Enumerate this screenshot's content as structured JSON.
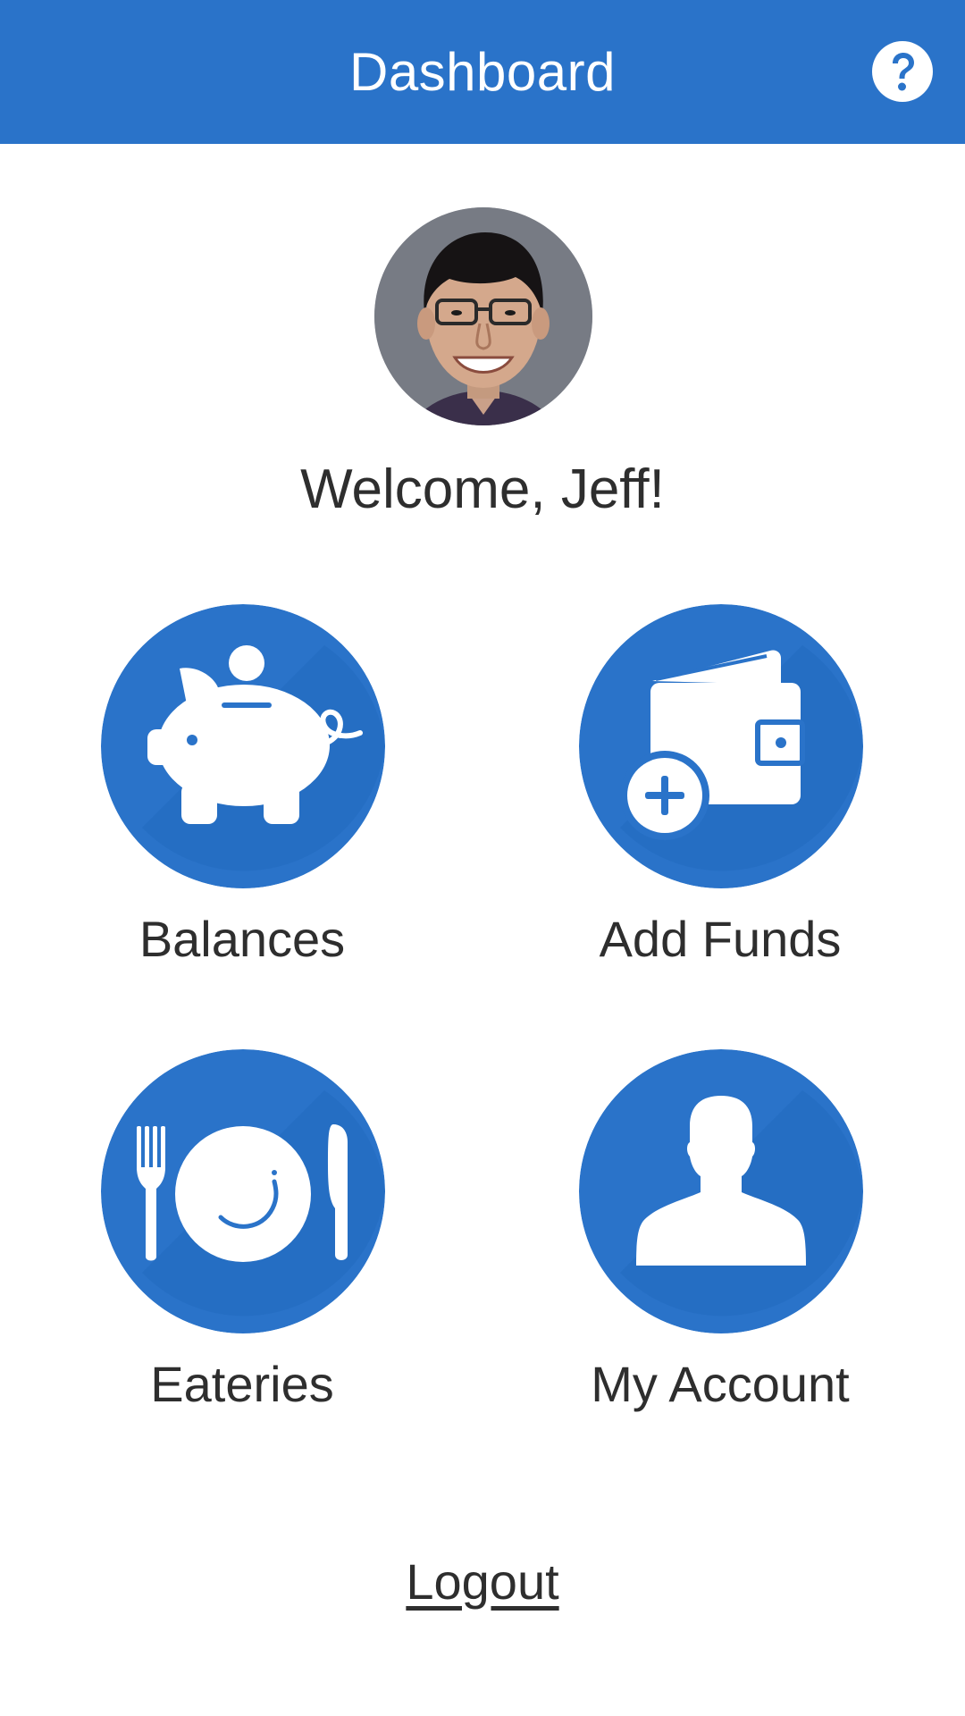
{
  "header": {
    "title": "Dashboard",
    "help_icon": "question-mark-icon",
    "background_color": "#2a73c9"
  },
  "profile": {
    "avatar_icon": "user-photo",
    "welcome_text": "Welcome, Jeff!"
  },
  "tiles": [
    {
      "label": "Balances",
      "icon": "piggy-bank-icon"
    },
    {
      "label": "Add Funds",
      "icon": "wallet-add-icon"
    },
    {
      "label": "Eateries",
      "icon": "plate-fork-knife-icon"
    },
    {
      "label": "My Account",
      "icon": "user-silhouette-icon"
    }
  ],
  "logout": {
    "label": "Logout"
  },
  "colors": {
    "accent": "#2a73c9",
    "text": "#2e2e2e"
  }
}
